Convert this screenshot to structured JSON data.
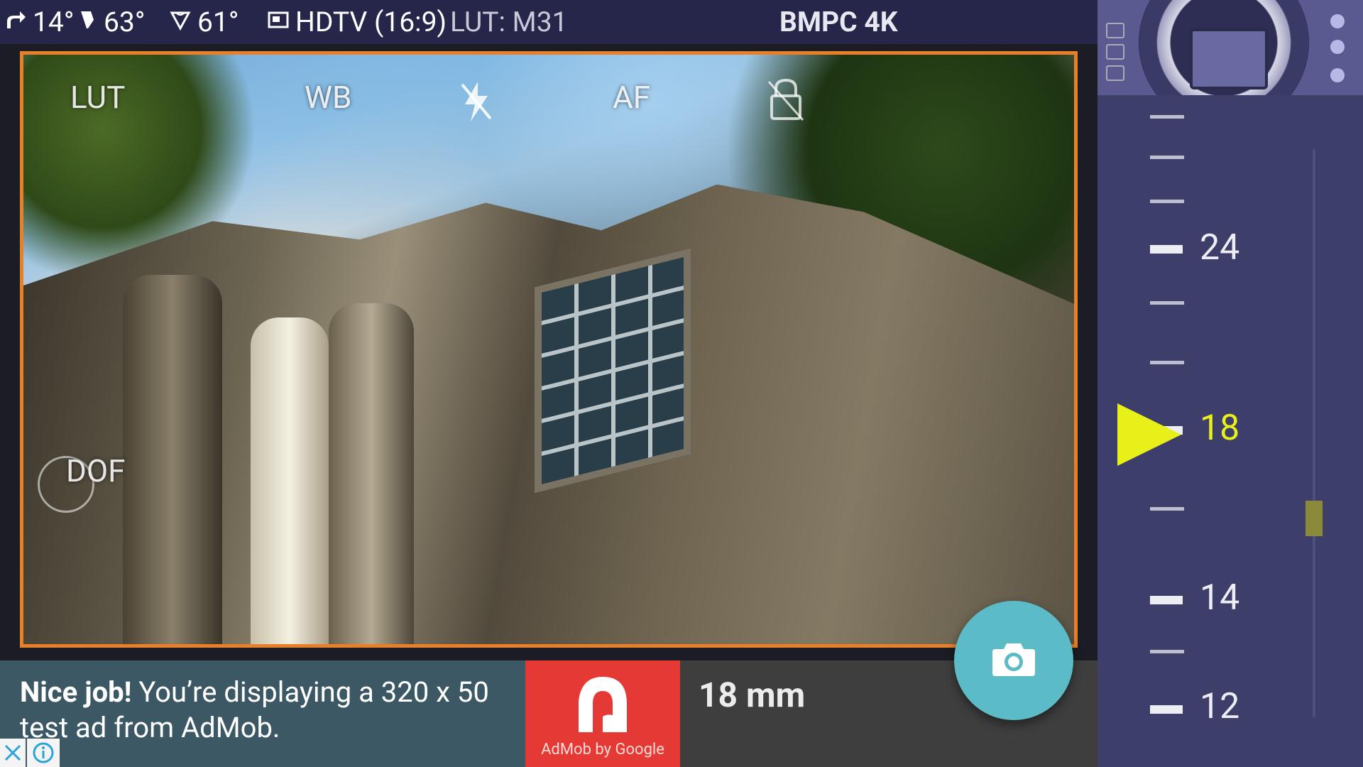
{
  "status_bar": {
    "tilt_value": "14°",
    "pitch_value": "63°",
    "fov_value": "61°",
    "format_value": "HDTV (16:9)",
    "lut_value": "LUT: M31",
    "camera_model": "BMPC 4K"
  },
  "viewfinder": {
    "lut_label": "LUT",
    "wb_label": "WB",
    "af_label": "AF",
    "dof_label": "DOF",
    "frame_color": "#e8802a"
  },
  "ad": {
    "bold_text": "Nice job!",
    "body_text": "You’re displaying a 320 x 50 test ad from AdMob.",
    "brand_caption": "AdMob by Google"
  },
  "focal_length": "18 mm",
  "focal_scale": {
    "labels": [
      "24",
      "18",
      "14",
      "12"
    ],
    "active_label": "18",
    "active_color": "#e8f01a"
  },
  "colors": {
    "topbar_bg": "#26264a",
    "panel_bg": "#3e3e6a",
    "shutter": "#5bbcc7",
    "ad_bg": "#3d5865",
    "admob_red": "#e53935"
  }
}
